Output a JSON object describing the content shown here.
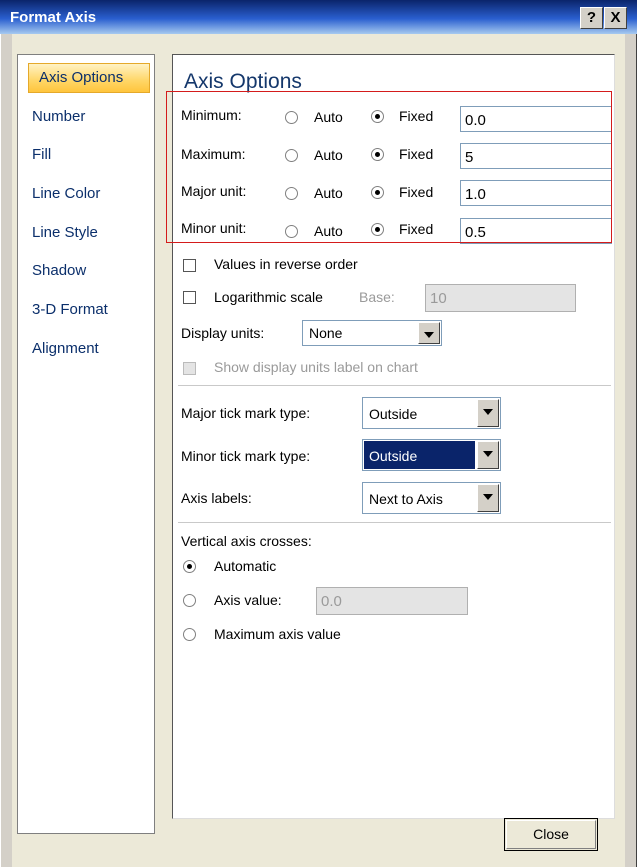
{
  "window": {
    "title": "Format Axis",
    "help_label": "?",
    "close_label": "X"
  },
  "sidebar": {
    "items": [
      {
        "label": "Axis Options",
        "active": true
      },
      {
        "label": "Number"
      },
      {
        "label": "Fill"
      },
      {
        "label": "Line Color"
      },
      {
        "label": "Line Style"
      },
      {
        "label": "Shadow"
      },
      {
        "label": "3-D Format"
      },
      {
        "label": "Alignment"
      }
    ]
  },
  "axis_options": {
    "heading": "Axis Options",
    "rows": [
      {
        "label": "Minimum:",
        "auto_label": "Auto",
        "fixed_label": "Fixed",
        "value": "0.0"
      },
      {
        "label": "Maximum:",
        "auto_label": "Auto",
        "fixed_label": "Fixed",
        "value": "5"
      },
      {
        "label": "Major unit:",
        "auto_label": "Auto",
        "fixed_label": "Fixed",
        "value": "1.0"
      },
      {
        "label": "Minor unit:",
        "auto_label": "Auto",
        "fixed_label": "Fixed",
        "value": "0.5"
      }
    ],
    "reverse_order_label": "Values in reverse order",
    "log_scale_label": "Logarithmic scale",
    "base_label": "Base:",
    "base_value": "10",
    "display_units_label": "Display units:",
    "display_units_value": "None",
    "show_units_label": "Show display units label on chart",
    "major_tick_label": "Major tick mark type:",
    "major_tick_value": "Outside",
    "minor_tick_label": "Minor tick mark type:",
    "minor_tick_value": "Outside",
    "axis_labels_label": "Axis labels:",
    "axis_labels_value": "Next to Axis",
    "vertical_crosses_label": "Vertical axis crosses:",
    "automatic_label": "Automatic",
    "axis_value_label": "Axis value:",
    "axis_value_value": "0.0",
    "max_axis_value_label": "Maximum axis value"
  },
  "footer": {
    "close_label": "Close"
  },
  "colors": {
    "highlight_box": "#d41b1b",
    "selection": "#0a246a",
    "title_bar": "#0a246a"
  }
}
